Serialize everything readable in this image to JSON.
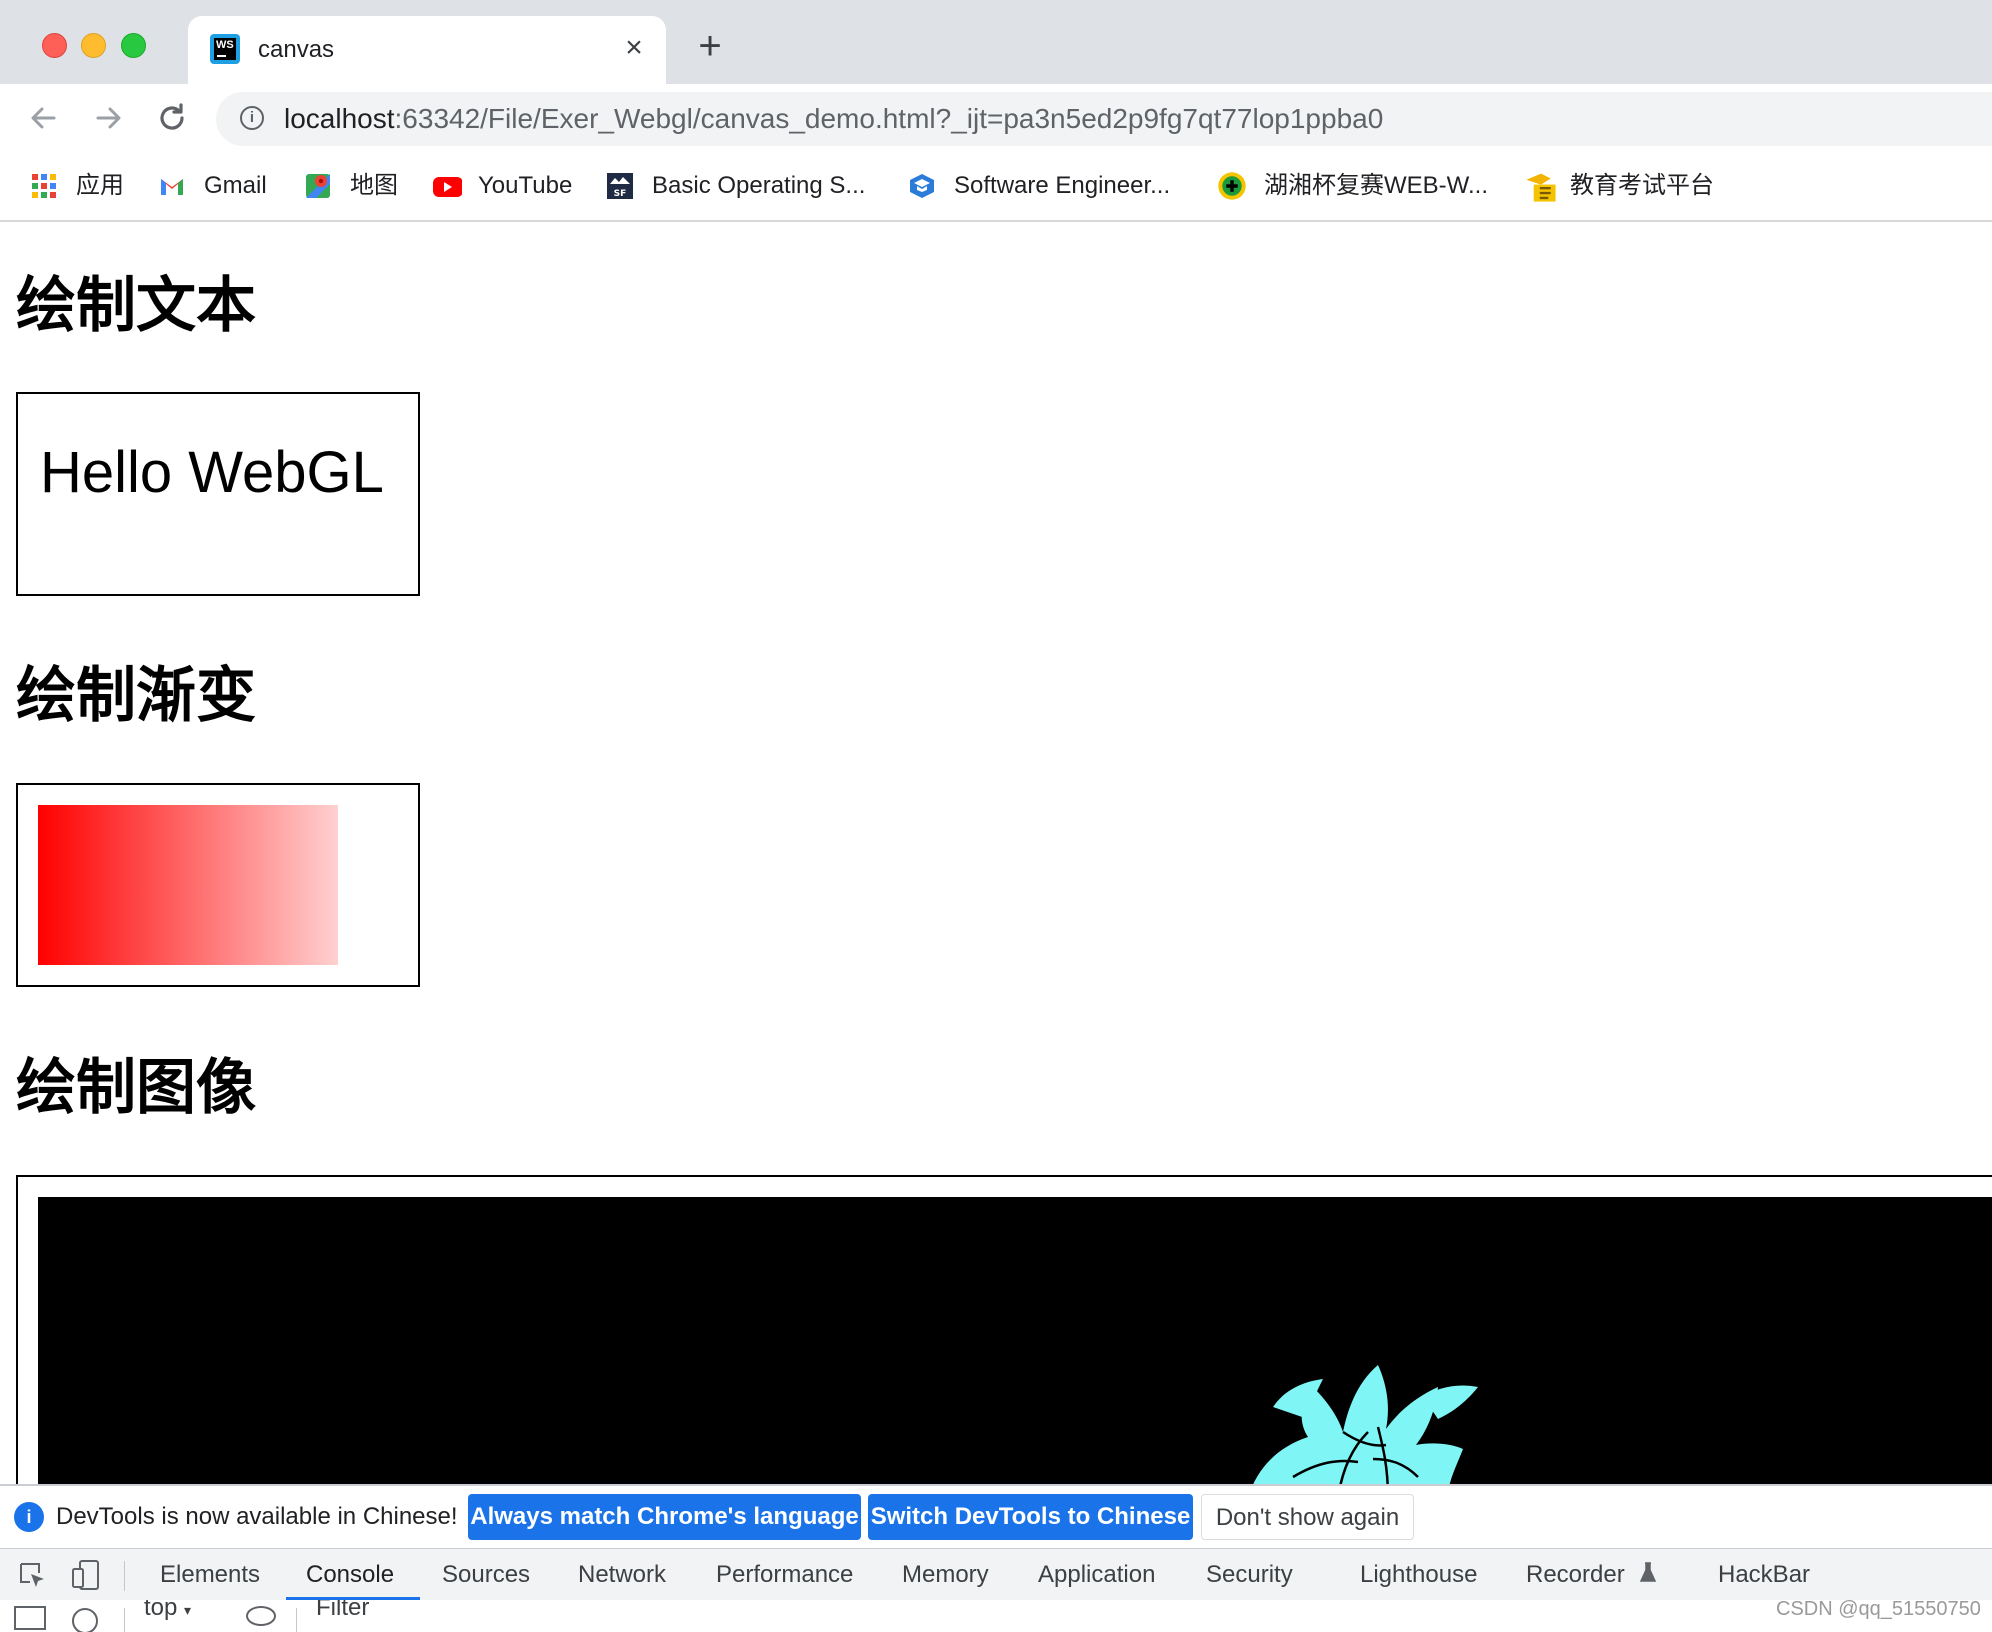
{
  "browser": {
    "tab": {
      "title": "canvas",
      "favicon": "webstorm-icon"
    },
    "new_tab": "+",
    "url": {
      "host": "localhost",
      "rest": ":63342/File/Exer_Webgl/canvas_demo.html?_ijt=pa3n5ed2p9fg7qt77lop1ppba0"
    },
    "bookmarks": [
      {
        "label": "应用",
        "icon": "apps-grid-icon"
      },
      {
        "label": "Gmail",
        "icon": "gmail-icon"
      },
      {
        "label": "地图",
        "icon": "maps-icon"
      },
      {
        "label": "YouTube",
        "icon": "youtube-icon"
      },
      {
        "label": "Basic Operating S...",
        "icon": "sf-icon"
      },
      {
        "label": "Software Engineer...",
        "icon": "cap-icon"
      },
      {
        "label": "湖湘杯复赛WEB-W...",
        "icon": "plus-badge-icon"
      },
      {
        "label": "教育考试平台",
        "icon": "exam-icon"
      }
    ]
  },
  "page": {
    "heading_text": "绘制文本",
    "hello_text": "Hello WebGL",
    "heading_gradient": "绘制渐变",
    "gradient_colors": [
      "#ff0000",
      "#ffd0d0"
    ],
    "heading_image": "绘制图像",
    "image_flower_color": "#7ff5f5"
  },
  "devtools": {
    "info_text": "DevTools is now available in Chinese!",
    "btn_always": "Always match Chrome's language",
    "btn_switch": "Switch DevTools to Chinese",
    "btn_dont": "Don't show again",
    "tabs": [
      "Elements",
      "Console",
      "Sources",
      "Network",
      "Performance",
      "Memory",
      "Application",
      "Security",
      "Lighthouse",
      "Recorder",
      "HackBar"
    ],
    "active_tab": "Console",
    "console_context": "top",
    "filter_placeholder": "Filter"
  },
  "watermark": "CSDN @qq_51550750"
}
